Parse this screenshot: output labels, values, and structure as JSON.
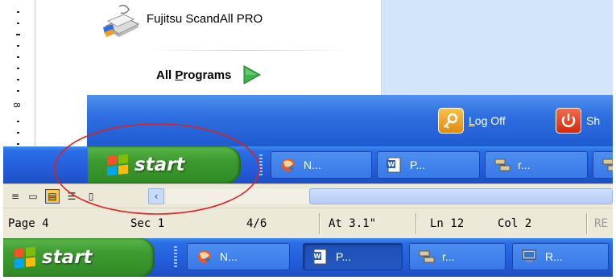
{
  "start_menu": {
    "pinned_item": {
      "label": "Fujitsu ScandAll PRO",
      "icon": "scanner-icon"
    },
    "all_programs": {
      "prefix": "All ",
      "accel": "P",
      "suffix": "rograms",
      "icon": "green-arrow-icon"
    },
    "logoff": {
      "prefix": "",
      "accel": "L",
      "suffix": "og Off",
      "icon": "key-icon"
    },
    "shutdown": {
      "label": "Sh",
      "icon": "power-icon"
    }
  },
  "taskbar_top": {
    "start_label": "start",
    "buttons": [
      {
        "label": "N...",
        "icon": "globe-app-icon",
        "active": false
      },
      {
        "label": "P...",
        "icon": "word-doc-icon",
        "active": false
      },
      {
        "label": "r...",
        "icon": "network-icon",
        "active": false
      }
    ]
  },
  "view_toolbar": {
    "buttons": [
      "normal-view-icon",
      "web-layout-icon",
      "print-layout-icon",
      "outline-view-icon",
      "reading-layout-icon"
    ],
    "selected": "print-layout-icon",
    "scroll_left": "‹"
  },
  "status_bar": {
    "page": "Page 4",
    "section": "Sec 1",
    "pages": "4/6",
    "at": "At 3.1\"",
    "line": "Ln 12",
    "col": "Col 2",
    "rec": "RE"
  },
  "taskbar_bottom": {
    "start_label": "start",
    "buttons": [
      {
        "label": "N...",
        "icon": "globe-app-icon",
        "active": false
      },
      {
        "label": "P...",
        "icon": "word-doc-icon",
        "active": true
      },
      {
        "label": "r...",
        "icon": "network-icon",
        "active": false
      },
      {
        "label": "R...",
        "icon": "computer-icon",
        "active": false
      }
    ]
  },
  "ruler": {
    "visible_number": "8"
  },
  "colors": {
    "taskbar_blue": "#245dda",
    "start_green": "#3d9a30",
    "annotation_red": "#e02020",
    "menu_right_bg": "#d3e5fa"
  }
}
